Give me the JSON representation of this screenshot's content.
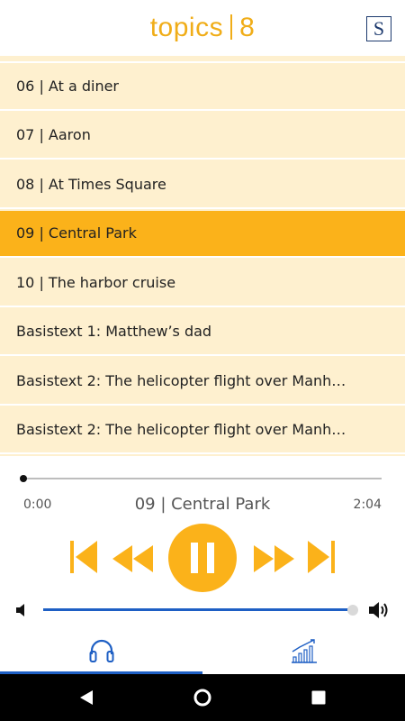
{
  "header": {
    "logo_word": "topics",
    "logo_number": "8",
    "badge_letter": "S"
  },
  "playlist": {
    "items": [
      {
        "label": "06 | At a diner",
        "active": false
      },
      {
        "label": "07 | Aaron",
        "active": false
      },
      {
        "label": "08 | At Times Square",
        "active": false
      },
      {
        "label": "09 | Central Park",
        "active": true
      },
      {
        "label": "10 | The harbor cruise",
        "active": false
      },
      {
        "label": "Basistext 1: Matthew’s dad",
        "active": false
      },
      {
        "label": "Basistext 2: The helicopter flight over Manhat…",
        "active": false
      },
      {
        "label": "Basistext 2: The helicopter flight over Manhat…",
        "active": false
      }
    ]
  },
  "player": {
    "current_time": "0:00",
    "duration": "2:04",
    "now_playing": "09 | Central Park",
    "progress_fraction": 0.0,
    "volume_fraction": 1.0
  },
  "icons": {
    "skip_start": "skip-to-start-icon",
    "rewind": "rewind-icon",
    "pause": "pause-icon",
    "fast_forward": "fast-forward-icon",
    "skip_end": "skip-to-end-icon",
    "volume_low": "speaker-low-icon",
    "volume_high": "speaker-high-icon",
    "tab_audio": "headphones-icon",
    "tab_stats": "chart-growth-icon",
    "nav_back": "back-triangle-icon",
    "nav_home": "home-circle-icon",
    "nav_recents": "recents-square-icon"
  },
  "colors": {
    "accent": "#fbb21a",
    "list_bg": "#fef0cf",
    "brand_blue": "#1e5fc4",
    "logo_orange": "#f0ad18"
  }
}
